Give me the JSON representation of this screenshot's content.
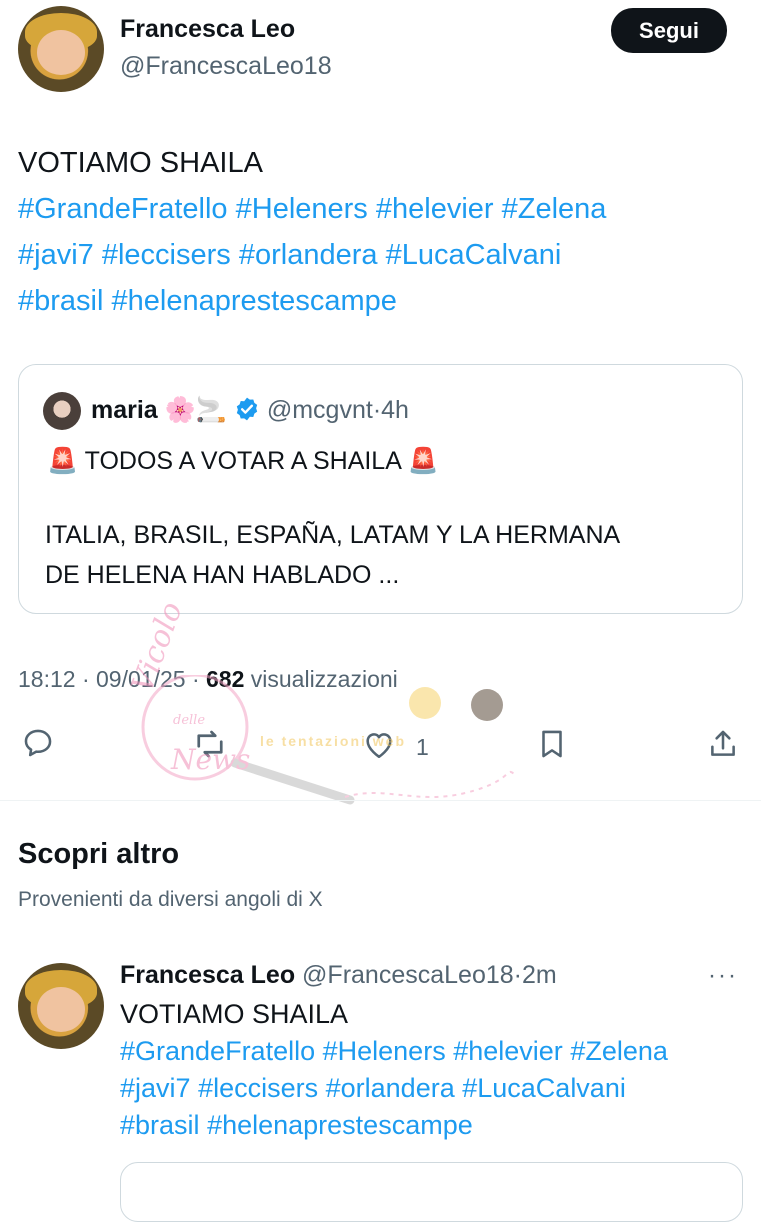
{
  "post": {
    "author_name": "Francesca Leo",
    "author_handle": "@FrancescaLeo18",
    "follow_label": "Segui",
    "text_line1": "VOTIAMO SHAILA",
    "hashtags_row1": [
      "#GrandeFratello",
      "#Heleners",
      "#helevier",
      "#Zelena"
    ],
    "hashtags_row2": [
      "#javi7",
      "#leccisers",
      "#orlandera",
      "#LucaCalvani"
    ],
    "hashtags_row3": [
      "#brasil",
      "#helenaprestescampe"
    ]
  },
  "quote": {
    "name": "maria",
    "emojis": "🌸🚬",
    "handle": "@mcgvnt",
    "separator": "·",
    "time": "4h",
    "siren": "🚨",
    "headline": "TODOS A VOTAR A SHAILA",
    "body_line1": "ITALIA, BRASIL, ESPAÑA, LATAM Y LA HERMANA",
    "body_line2": "DE HELENA HAN HABLADO ..."
  },
  "meta": {
    "time": "18:12",
    "sep1": "·",
    "date": "09/01/25",
    "sep2": "·",
    "views_count": "682",
    "views_label": "visualizzazioni"
  },
  "actions": {
    "like_count": "1"
  },
  "discover": {
    "title": "Scopri altro",
    "subtitle": "Provenienti da diversi angoli di X"
  },
  "post2": {
    "author_name": "Francesca Leo",
    "author_handle": "@FrancescaLeo18",
    "separator": "·",
    "time": "2m",
    "more": "···",
    "text_line1": "VOTIAMO SHAILA",
    "hashtags_row1": [
      "#GrandeFratello",
      "#Heleners",
      "#helevier",
      "#Zelena"
    ],
    "hashtags_row2": [
      "#javi7",
      "#leccisers",
      "#orlandera",
      "#LucaCalvani"
    ],
    "hashtags_row3": [
      "#brasil",
      "#helenaprestescampe"
    ]
  },
  "watermark": {
    "text1": "Vicolo",
    "text2": "delle",
    "text3": "News",
    "banner": "le tentazioni web"
  },
  "colors": {
    "accent": "#1d9bf0",
    "text": "#0f1419",
    "secondary": "#536471",
    "border": "#cfd9de"
  }
}
